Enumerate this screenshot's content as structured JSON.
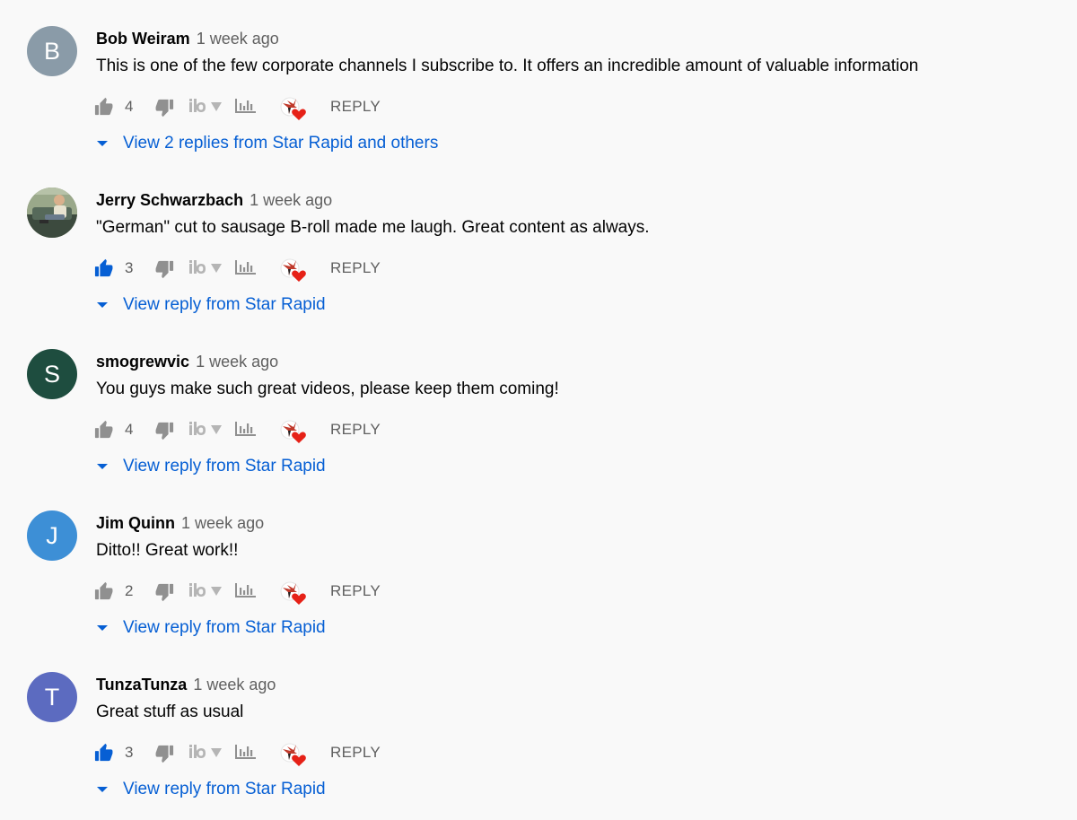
{
  "comments": [
    {
      "author": "Bob Weiram",
      "time": "1 week ago",
      "text": "This is one of the few corporate channels I subscribe to. It offers an incredible amount of valuable information",
      "avatar_letter": "B",
      "avatar_color": "#8a9ba8",
      "likes": "4",
      "liked": false,
      "reply_label": "REPLY",
      "replies_label": "View 2 replies from Star Rapid and others"
    },
    {
      "author": "Jerry Schwarzbach",
      "time": "1 week ago",
      "text": "\"German\" cut to sausage B-roll made me laugh. Great content as always.",
      "avatar_letter": "",
      "avatar_color": "#7d8a6a",
      "avatar_photo": true,
      "likes": "3",
      "liked": true,
      "reply_label": "REPLY",
      "replies_label": "View reply from Star Rapid"
    },
    {
      "author": "smogrewvic",
      "time": "1 week ago",
      "text": "You guys make such great videos, please keep them coming!",
      "avatar_letter": "S",
      "avatar_color": "#1e4d3f",
      "likes": "4",
      "liked": false,
      "reply_label": "REPLY",
      "replies_label": "View reply from Star Rapid"
    },
    {
      "author": "Jim Quinn",
      "time": "1 week ago",
      "text": "Ditto!!  Great work!!",
      "avatar_letter": "J",
      "avatar_color": "#3d8fd6",
      "likes": "2",
      "liked": false,
      "reply_label": "REPLY",
      "replies_label": "View reply from Star Rapid"
    },
    {
      "author": "TunzaTunza",
      "time": "1 week ago",
      "text": "Great stuff as usual",
      "avatar_letter": "T",
      "avatar_color": "#5c6bc0",
      "likes": "3",
      "liked": true,
      "reply_label": "REPLY",
      "replies_label": "View reply from Star Rapid"
    }
  ],
  "colors": {
    "liked": "#065fd4",
    "icon": "#909090",
    "link": "#065fd4",
    "heart": "#e62117"
  },
  "icons": {
    "like": "thumbs-up-icon",
    "dislike": "thumbs-down-icon",
    "ext1": "tube-logo-dropdown-icon",
    "ext2": "stats-chart-icon",
    "ext3": "creator-heart-icon",
    "expand": "caret-down-icon"
  }
}
